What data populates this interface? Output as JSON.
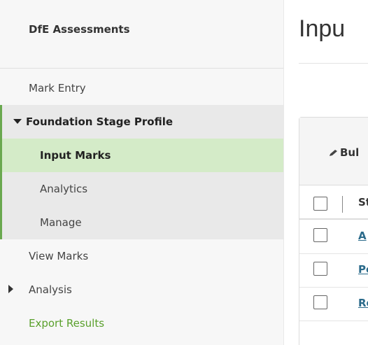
{
  "sidebar": {
    "brand": "DfE Assessments",
    "items": {
      "mark_entry": "Mark Entry",
      "foundation_stage_profile": "Foundation Stage Profile",
      "input_marks": "Input Marks",
      "analytics": "Analytics",
      "manage": "Manage",
      "view_marks": "View Marks",
      "analysis": "Analysis",
      "export_results": "Export Results"
    }
  },
  "main": {
    "title": "Inpu",
    "bulk_button": "Bul",
    "column_header": "St",
    "rows": [
      "A",
      "Pe",
      "Re"
    ]
  },
  "colors": {
    "accent": "#6aa84f",
    "active_bg": "#d4ebc8",
    "link": "#2a6a8a"
  }
}
